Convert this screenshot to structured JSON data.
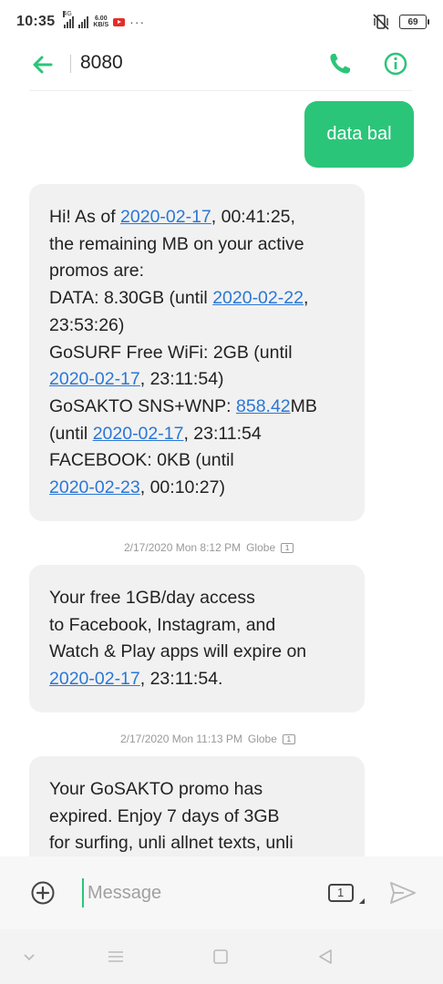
{
  "status_bar": {
    "time": "10:35",
    "signal_tag": "4G",
    "speed_value": "6.00",
    "speed_unit": "KB/S",
    "more": "···",
    "battery": "69"
  },
  "header": {
    "title": "8080"
  },
  "messages": {
    "outgoing": [
      {
        "text": "data bal"
      }
    ],
    "incoming": [
      {
        "lines": [
          [
            {
              "t": "Hi! As of "
            },
            {
              "t": "2020-02-17",
              "link": true
            },
            {
              "t": ", 00:41:25,"
            }
          ],
          [
            {
              "t": "the remaining MB on your active"
            }
          ],
          [
            {
              "t": "promos are:"
            }
          ],
          [
            {
              "t": "DATA: 8.30GB (until "
            },
            {
              "t": "2020-02-22",
              "link": true
            },
            {
              "t": ","
            }
          ],
          [
            {
              "t": "23:53:26)"
            }
          ],
          [
            {
              "t": "GoSURF Free WiFi: 2GB (until"
            }
          ],
          [
            {
              "t": "2020-02-17",
              "link": true
            },
            {
              "t": ", 23:11:54)"
            }
          ],
          [
            {
              "t": "GoSAKTO SNS+WNP: "
            },
            {
              "t": "858.42",
              "link": true
            },
            {
              "t": "MB"
            }
          ],
          [
            {
              "t": "(until "
            },
            {
              "t": "2020-02-17",
              "link": true
            },
            {
              "t": ", 23:11:54"
            }
          ],
          [
            {
              "t": "FACEBOOK: 0KB (until"
            }
          ],
          [
            {
              "t": "2020-02-23",
              "link": true
            },
            {
              "t": ", 00:10:27)"
            }
          ]
        ],
        "meta": {
          "date": "2/17/2020 Mon 8:12 PM",
          "sender": "Globe",
          "sim": "1"
        }
      },
      {
        "lines": [
          [
            {
              "t": "Your free 1GB/day access"
            }
          ],
          [
            {
              "t": "to Facebook, Instagram, and"
            }
          ],
          [
            {
              "t": "Watch & Play apps will expire on"
            }
          ],
          [
            {
              "t": "2020-02-17",
              "link": true
            },
            {
              "t": ", 23:11:54."
            }
          ]
        ],
        "meta": {
          "date": "2/17/2020 Mon 11:13 PM",
          "sender": "Globe",
          "sim": "1"
        }
      },
      {
        "lines": [
          [
            {
              "t": "Your GoSAKTO promo has"
            }
          ],
          [
            {
              "t": "expired. Enjoy 7 days of 3GB"
            }
          ],
          [
            {
              "t": "for surfing, unli allnet texts, unli"
            }
          ]
        ]
      }
    ]
  },
  "composer": {
    "placeholder": "Message",
    "value": "",
    "sim": "1"
  },
  "colors": {
    "accent": "#2bc579",
    "link": "#2a77d6",
    "bubble_in": "#f1f1f1"
  }
}
